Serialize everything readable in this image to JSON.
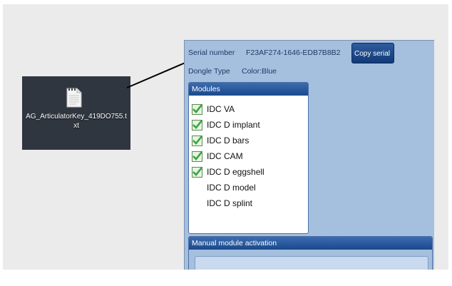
{
  "desktop": {
    "file_name": "AG_ArticulatorKey_419DO755.txt",
    "file_icon": "text-file-icon"
  },
  "app": {
    "serial_label": "Serial number",
    "serial_value": "F23AF274-1646-EDB7B8B2",
    "copy_serial_label": "Copy serial",
    "dongle_label": "Dongle Type",
    "dongle_value": "Color:Blue",
    "modules": {
      "title": "Modules",
      "items": [
        {
          "label": "IDC VA",
          "checked": true
        },
        {
          "label": "IDC D implant",
          "checked": true
        },
        {
          "label": "IDC D bars",
          "checked": true
        },
        {
          "label": "IDC CAM",
          "checked": true
        },
        {
          "label": "IDC D eggshell",
          "checked": true
        },
        {
          "label": "IDC D model",
          "checked": false
        },
        {
          "label": "IDC D splint",
          "checked": false
        }
      ]
    },
    "manual_activation_title": "Manual module activation"
  },
  "colors": {
    "panel_bg": "#a5bfdf",
    "header_blue": "#1a4a8c",
    "checkbox_green": "#3aa640",
    "desktop_bg": "#2f3640"
  }
}
